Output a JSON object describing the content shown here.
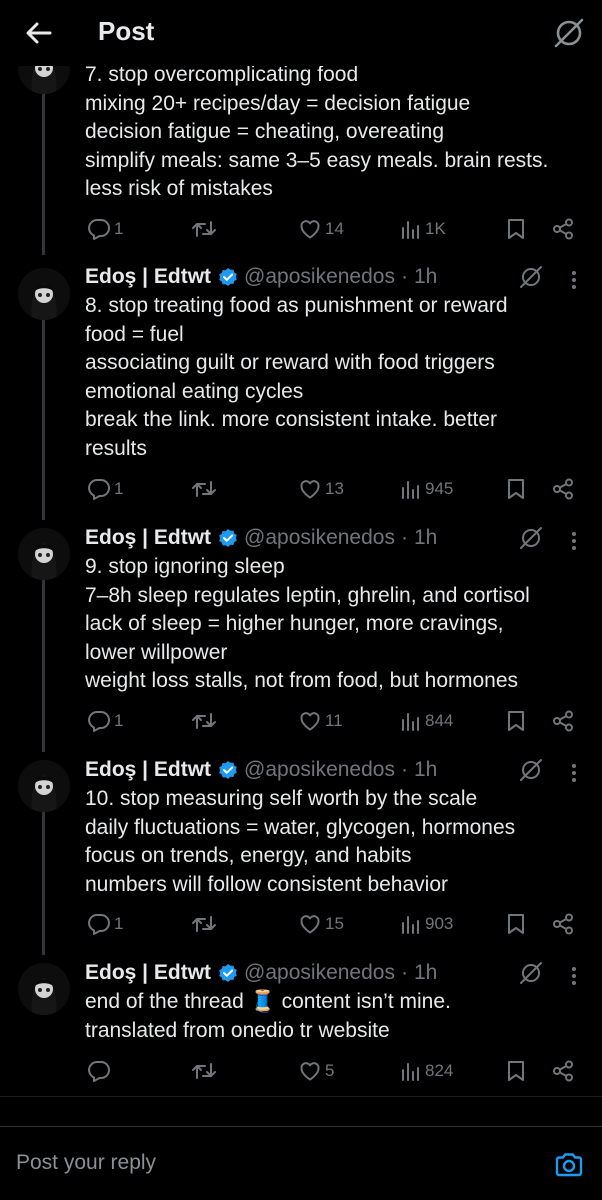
{
  "header": {
    "title": "Post"
  },
  "posts": [
    {
      "name": "",
      "handle": "",
      "time": "",
      "lines": [
        "7. stop overcomplicating food",
        "mixing 20+ recipes/day = decision fatigue",
        "decision fatigue = cheating, overeating",
        "simplify meals: same 3–5 easy meals. brain rests.",
        "less risk of mistakes"
      ],
      "replies": "1",
      "reposts": "",
      "likes": "14",
      "views": "1K"
    },
    {
      "name": "Edoş | Edtwt",
      "handle": "@aposikenedos",
      "time": "1h",
      "lines": [
        "8. stop treating food as punishment or reward",
        "food = fuel",
        "associating guilt or reward with food triggers",
        "emotional eating cycles",
        "break the link. more consistent intake. better",
        "results"
      ],
      "replies": "1",
      "reposts": "",
      "likes": "13",
      "views": "945"
    },
    {
      "name": "Edoş | Edtwt",
      "handle": "@aposikenedos",
      "time": "1h",
      "lines": [
        "9. stop ignoring sleep",
        "7–8h sleep regulates leptin, ghrelin, and cortisol",
        "lack of sleep = higher hunger, more cravings,",
        "lower willpower",
        "weight loss stalls, not from food, but hormones"
      ],
      "replies": "1",
      "reposts": "",
      "likes": "11",
      "views": "844"
    },
    {
      "name": "Edoş | Edtwt",
      "handle": "@aposikenedos",
      "time": "1h",
      "lines": [
        "10. stop measuring self worth by the scale",
        "daily fluctuations = water, glycogen, hormones",
        "focus on trends, energy, and habits",
        "numbers will follow consistent behavior"
      ],
      "replies": "1",
      "reposts": "",
      "likes": "15",
      "views": "903"
    },
    {
      "name": "Edoş | Edtwt",
      "handle": "@aposikenedos",
      "time": "1h",
      "lines": [
        "end of the thread 🧵 content isn’t mine.",
        "translated from onedio tr website"
      ],
      "replies": "",
      "reposts": "",
      "likes": "5",
      "views": "824"
    }
  ],
  "separator": "·",
  "reply": {
    "placeholder": "Post your reply"
  },
  "colors": {
    "verified": "#1d9bf0",
    "camera": "#1d9bf0",
    "muted": "#71767b"
  },
  "icons": [
    "back-arrow-icon",
    "grok-icon",
    "verified-badge-icon",
    "more-icon",
    "reply-icon",
    "repost-icon",
    "like-icon",
    "views-icon",
    "bookmark-icon",
    "share-icon",
    "camera-icon"
  ]
}
